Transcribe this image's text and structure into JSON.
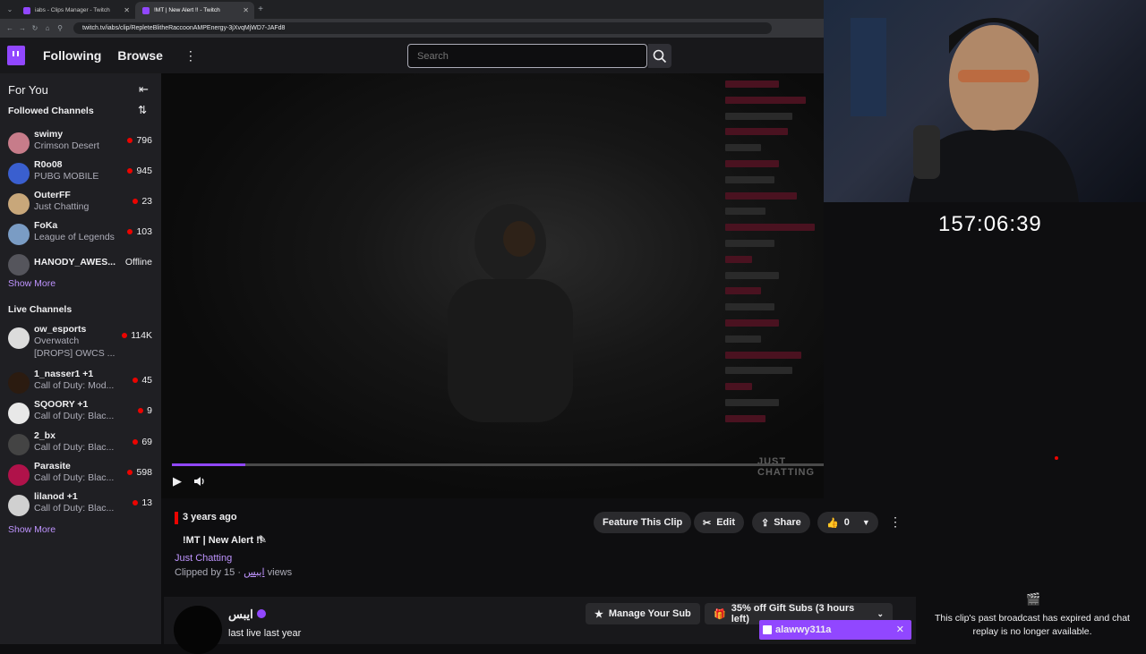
{
  "browser": {
    "tabs": [
      {
        "label": "iabs - Clips Manager - Twitch",
        "active": false
      },
      {
        "label": "!MT | New Alert !! - Twitch",
        "active": true
      }
    ],
    "url": "twitch.tv/iabs/clip/RepleteBlitheRaccoonAMPEnergy-3jXvqMjWD7-JAFd8"
  },
  "topnav": {
    "following": "Following",
    "browse": "Browse",
    "search_placeholder": "Search"
  },
  "sidebar": {
    "for_you": "For You",
    "followed_header": "Followed Channels",
    "followed": [
      {
        "name": "swimy",
        "game": "Crimson Desert",
        "viewers": "796",
        "live": true,
        "avatar_color": "#c77c8a"
      },
      {
        "name": "R0o08",
        "game": "PUBG MOBILE",
        "viewers": "945",
        "live": true,
        "avatar_color": "#3a5fcf"
      },
      {
        "name": "OuterFF",
        "game": "Just Chatting",
        "viewers": "23",
        "live": true,
        "avatar_color": "#c8a77a"
      },
      {
        "name": "FoKa",
        "game": "League of Legends",
        "viewers": "103",
        "live": true,
        "avatar_color": "#7a9cc4"
      },
      {
        "name": "HANODY_AWES...",
        "game": "",
        "viewers": "Offline",
        "live": false,
        "avatar_color": "#55555c"
      }
    ],
    "show_more_1": "Show More",
    "live_header": "Live Channels",
    "live": [
      {
        "name": "ow_esports",
        "game": "Overwatch",
        "extra": "[DROPS] OWCS ...",
        "viewers": "114K",
        "avatar_color": "#dcdcdc"
      },
      {
        "name": "1_nasser1 +1",
        "game": "Call of Duty: Mod...",
        "viewers": "45",
        "avatar_color": "#2b1b10"
      },
      {
        "name": "SQOORY +1",
        "game": "Call of Duty: Blac...",
        "viewers": "9",
        "avatar_color": "#e8e8e8"
      },
      {
        "name": "2_bx",
        "game": "Call of Duty: Blac...",
        "viewers": "69",
        "avatar_color": "#444"
      },
      {
        "name": "Parasite",
        "game": "Call of Duty: Blac...",
        "viewers": "598",
        "avatar_color": "#b0124a"
      },
      {
        "name": "lilanod +1",
        "game": "Call of Duty: Blac...",
        "viewers": "13",
        "avatar_color": "#d0d0d0"
      }
    ],
    "show_more_2": "Show More"
  },
  "player": {
    "progress": 0.1,
    "overlay_count": "26",
    "overlay_text": "JUST CHATTING"
  },
  "clip": {
    "age": "3 years ago",
    "title": "!MT | New Alert !!",
    "category": "Just Chatting",
    "clipped_by_label": "Clipped by",
    "clipper": "ايبس",
    "views": "· 15 views",
    "feature_label": "Feature This Clip",
    "edit_label": "Edit",
    "share_label": "Share",
    "likes": "0",
    "channel_name": "ايبس",
    "last_live": "last live last year",
    "manage_sub": "Manage Your Sub",
    "gift_subs": "35% off Gift Subs (3 hours left)",
    "toast_user": "alawwy311a"
  },
  "right": {
    "timer": "157:06:39",
    "notice": "This clip's past broadcast has expired and chat replay is no longer available."
  },
  "colors": {
    "brand": "#9147ff",
    "live": "#eb0400",
    "link": "#bf94ff"
  }
}
